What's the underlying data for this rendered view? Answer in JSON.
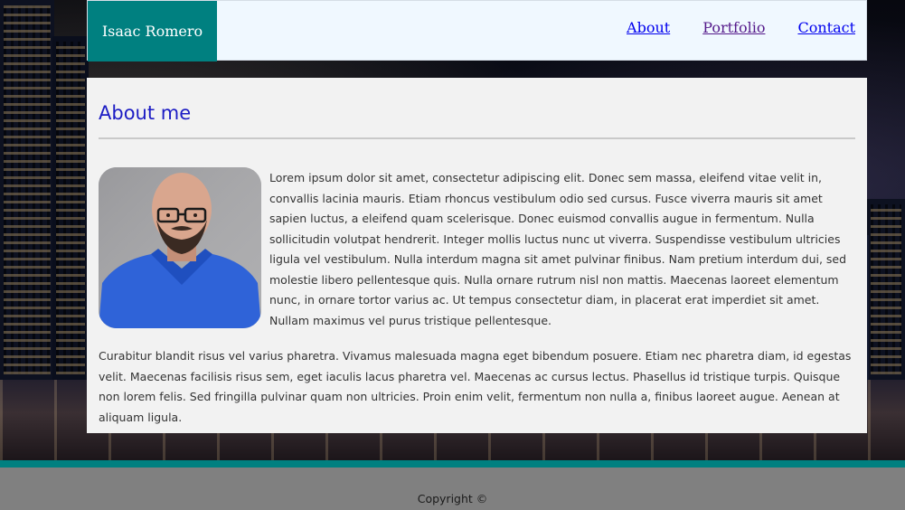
{
  "header": {
    "brand": "Isaac Romero",
    "nav": [
      {
        "label": "About"
      },
      {
        "label": "Portfolio"
      },
      {
        "label": "Contact"
      }
    ]
  },
  "main": {
    "title": "About me",
    "paragraph1": "Lorem ipsum dolor sit amet, consectetur adipiscing elit. Donec sem massa, eleifend vitae velit in, convallis lacinia mauris. Etiam rhoncus vestibulum odio sed cursus. Fusce viverra mauris sit amet sapien luctus, a eleifend quam scelerisque. Donec euismod convallis augue in fermentum. Nulla sollicitudin volutpat hendrerit. Integer mollis luctus nunc ut viverra. Suspendisse vestibulum ultricies ligula vel vestibulum. Nulla interdum magna sit amet pulvinar finibus. Nam pretium interdum dui, sed molestie libero pellentesque quis. Nulla ornare rutrum nisl non mattis. Maecenas laoreet elementum nunc, in ornare tortor varius ac. Ut tempus consectetur diam, in placerat erat imperdiet sit amet. Nullam maximus vel purus tristique pellentesque.",
    "paragraph2": "Curabitur blandit risus vel varius pharetra. Vivamus malesuada magna eget bibendum posuere. Etiam nec pharetra diam, id egestas velit. Maecenas facilisis risus sem, eget iaculis lacus pharetra vel. Maecenas ac cursus lectus. Phasellus id tristique turpis. Quisque non lorem felis. Sed fringilla pulvinar quam non ultricies. Proin enim velit, fermentum non nulla a, finibus laoreet augue. Aenean at aliquam ligula."
  },
  "footer": {
    "copyright": "Copyright ©"
  },
  "colors": {
    "brand_bg": "#008080",
    "header_bg": "#f0f8ff",
    "title": "#1c1cc4",
    "link": "#0000ee",
    "visited_link": "#551a8b",
    "footer_bg": "#808080"
  }
}
